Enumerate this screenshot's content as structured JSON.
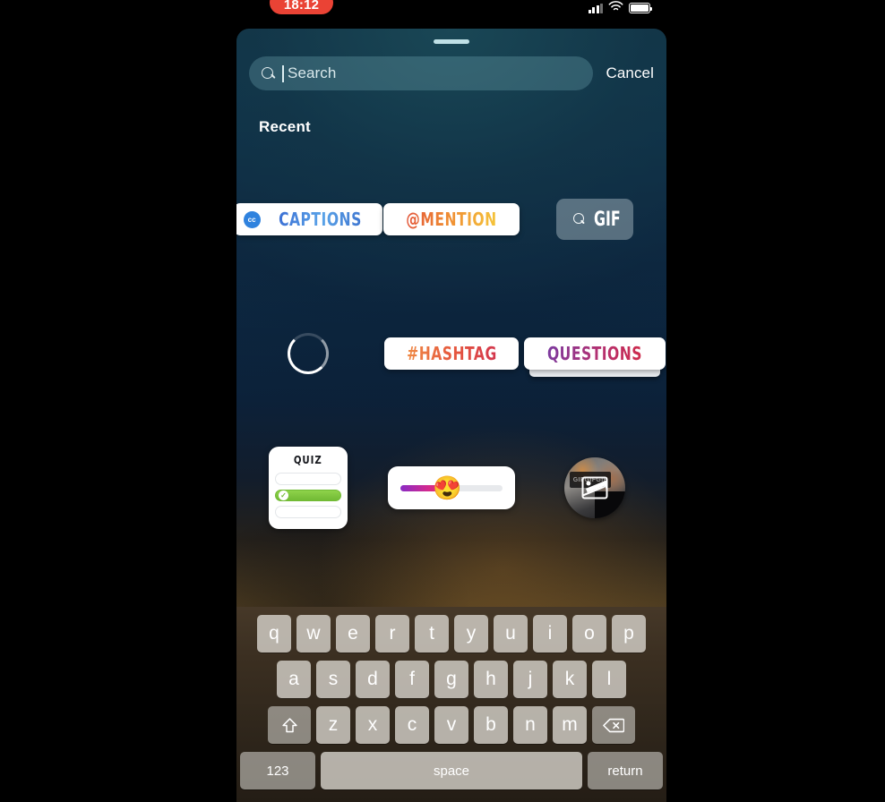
{
  "status_bar": {
    "time": "18:12",
    "recording_indicator": true,
    "signal_icon": "cellular-signal-icon",
    "wifi_icon": "wifi-icon",
    "battery_icon": "battery-full-icon",
    "recording_pill_color": "#ea4335"
  },
  "search": {
    "placeholder": "Search",
    "value": "",
    "icon": "search-icon",
    "cancel_label": "Cancel"
  },
  "section": {
    "recent_label": "Recent"
  },
  "stickers": {
    "rows": [
      [
        {
          "name": "captions-sticker",
          "label": "CAPTIONS",
          "badge": "cc",
          "style": "captions"
        },
        {
          "name": "mention-sticker",
          "label": "@MENTION",
          "style": "mention"
        },
        {
          "name": "gif-sticker",
          "label": "GIF",
          "style": "gif"
        }
      ],
      [
        {
          "name": "loading-spinner-sticker",
          "label": "",
          "style": "spinner"
        },
        {
          "name": "hashtag-sticker",
          "label": "#HASHTAG",
          "style": "hashtag"
        },
        {
          "name": "questions-sticker",
          "label": "QUESTIONS",
          "style": "questions"
        }
      ],
      [
        {
          "name": "quiz-sticker",
          "label": "QUIZ",
          "style": "quiz"
        },
        {
          "name": "emoji-slider-sticker",
          "label": "",
          "emoji": "😍",
          "fill_percent": 46,
          "style": "slider"
        },
        {
          "name": "photo-sticker",
          "label": "GIFGIFGIF",
          "style": "photo"
        }
      ]
    ]
  },
  "keyboard": {
    "row1": [
      "q",
      "w",
      "e",
      "r",
      "t",
      "y",
      "u",
      "i",
      "o",
      "p"
    ],
    "row2": [
      "a",
      "s",
      "d",
      "f",
      "g",
      "h",
      "j",
      "k",
      "l"
    ],
    "row3": [
      "z",
      "x",
      "c",
      "v",
      "b",
      "n",
      "m"
    ],
    "shift_icon": "shift-icon",
    "backspace_icon": "backspace-icon",
    "numbers_label": "123",
    "space_label": "space",
    "return_label": "return"
  },
  "colors": {
    "accent_red": "#ea4335",
    "search_fill": "rgba(120,175,185,0.30)",
    "quiz_green": "#72bb35"
  }
}
